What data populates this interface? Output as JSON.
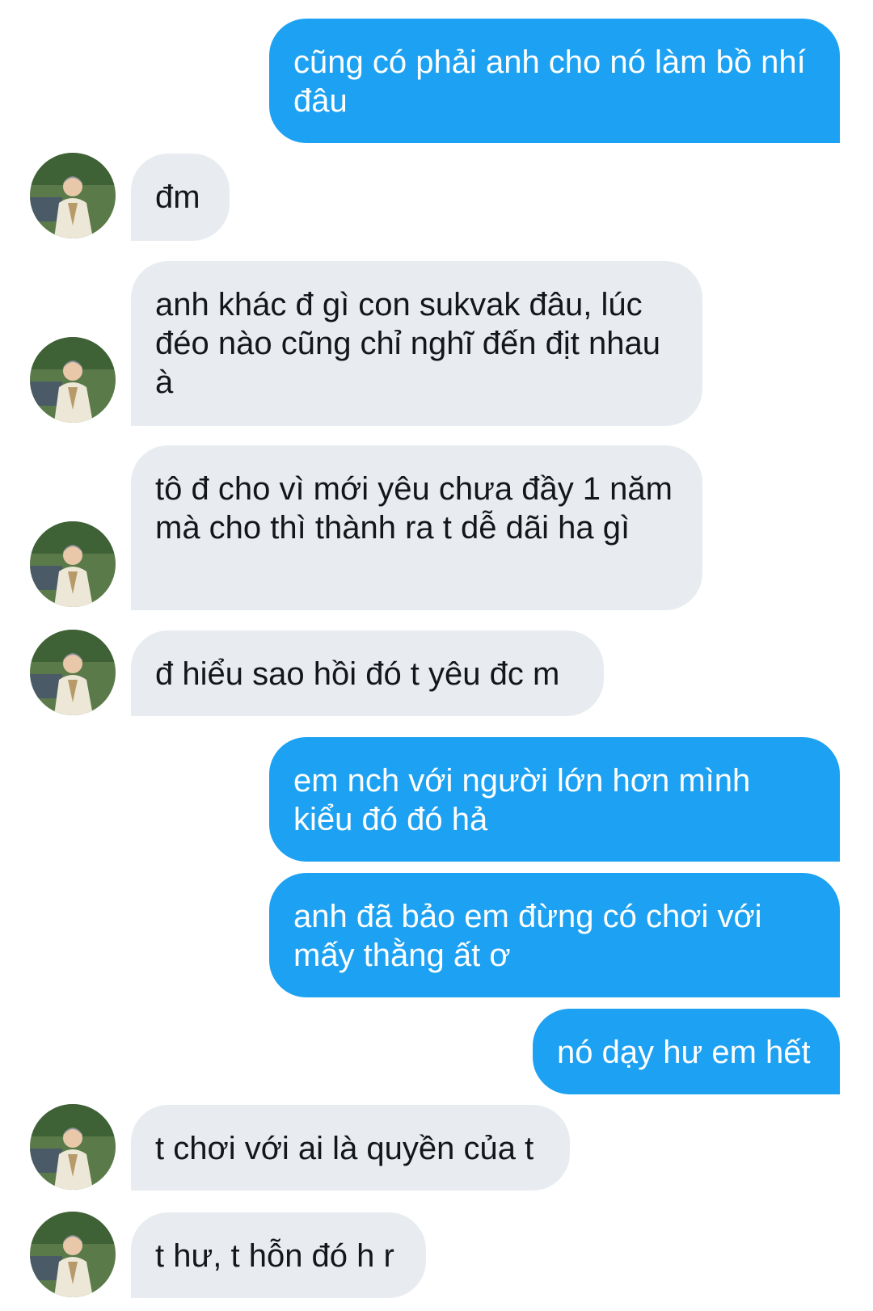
{
  "conversation": {
    "messages": [
      {
        "from": "me",
        "text": "cũng có phải anh cho nó làm bồ nhí đâu"
      },
      {
        "from": "them",
        "text": "đm"
      },
      {
        "from": "them",
        "text": "anh khác đ gì con sukvak đâu, lúc đéo nào cũng chỉ nghĩ đến địt nhau à"
      },
      {
        "from": "them",
        "text": "tô đ cho vì mới yêu chưa đầy 1 năm mà cho thì thành ra t dễ dãi ha gì"
      },
      {
        "from": "them",
        "text": "đ hiểu sao hồi đó t yêu đc m"
      },
      {
        "from": "me",
        "text": "em nch với người lớn hơn mình kiểu đó đó hả"
      },
      {
        "from": "me",
        "text": "anh đã bảo em đừng có chơi với mấy thằng ất ơ"
      },
      {
        "from": "me",
        "text": "nó dạy hư em hết"
      },
      {
        "from": "them",
        "text": "t chơi với ai là quyền của t"
      },
      {
        "from": "them",
        "text": "t hư, t hỗn đó h r"
      }
    ]
  },
  "colors": {
    "sent_bubble": "#1da1f2",
    "received_bubble": "#e8ecf0",
    "sent_text": "#ffffff",
    "received_text": "#14171a"
  },
  "icons": {
    "avatar": "contact-avatar-photo"
  }
}
